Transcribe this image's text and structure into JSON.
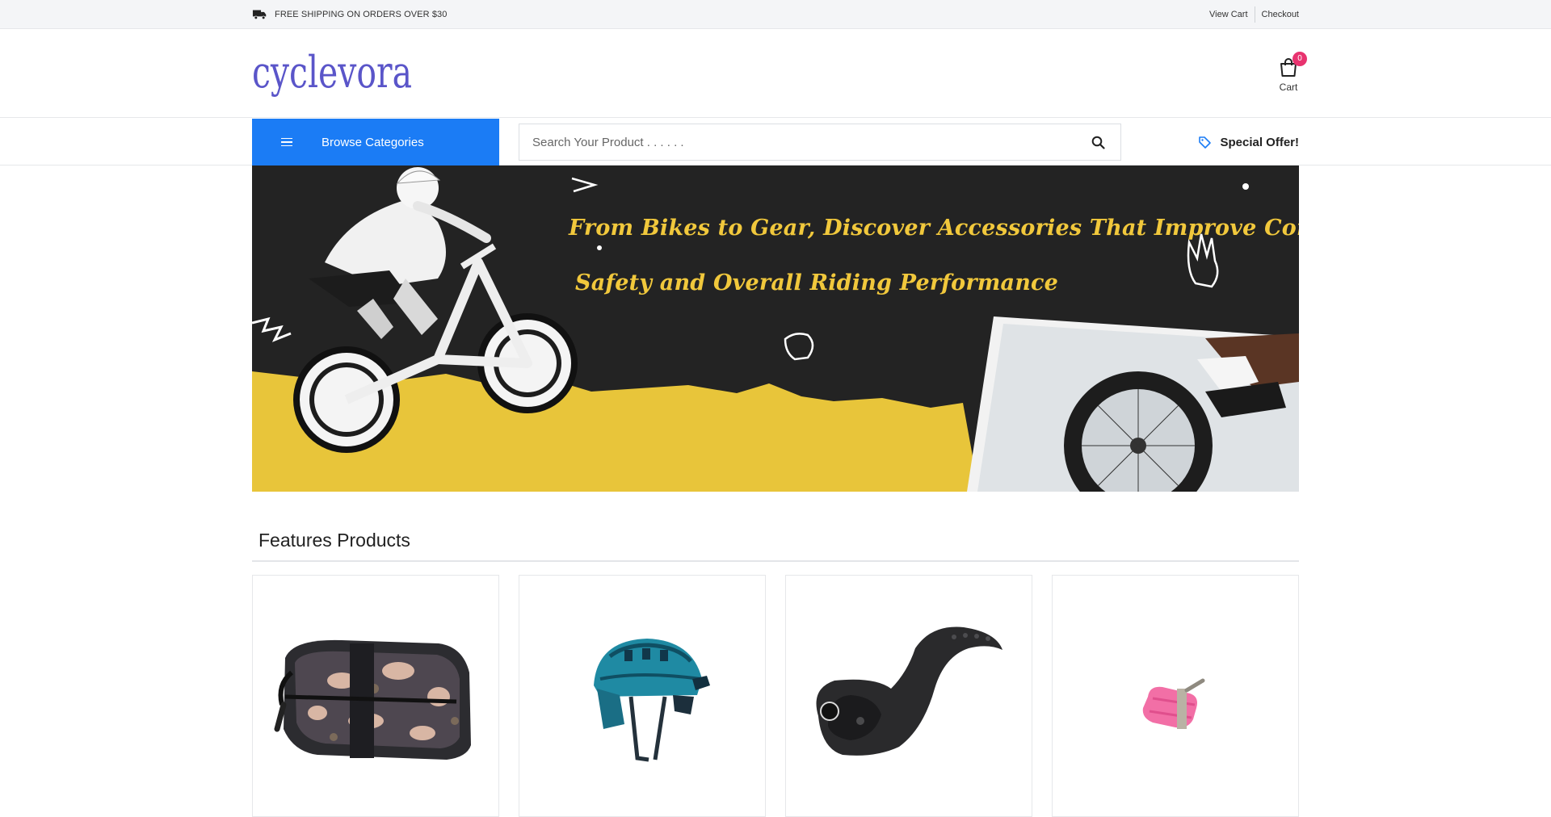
{
  "topbar": {
    "shipping_text": "FREE SHIPPING ON ORDERS OVER $30",
    "links": [
      "View Cart",
      "Checkout"
    ]
  },
  "header": {
    "logo_text": "cyclevora",
    "cart": {
      "count": "0",
      "label": "Cart"
    }
  },
  "nav": {
    "browse_label": "Browse Categories",
    "search_placeholder": "Search Your Product . . . . . .",
    "special_offer": "Special Offer!"
  },
  "banner": {
    "line1": "From Bikes to Gear, Discover Accessories That Improve Comfort",
    "line2": "Safety and Overall Riding Performance"
  },
  "features": {
    "title": "Features Products",
    "products": [
      {
        "image": "saddle-bag"
      },
      {
        "image": "helmet"
      },
      {
        "image": "brake-lever"
      },
      {
        "image": "pink-tube"
      }
    ]
  },
  "colors": {
    "accent": "#1b7cf5",
    "badge": "#e8336f",
    "banner_text": "#f1c83c",
    "banner_yellow": "#e8c53a",
    "logo": "#5a55c9"
  }
}
